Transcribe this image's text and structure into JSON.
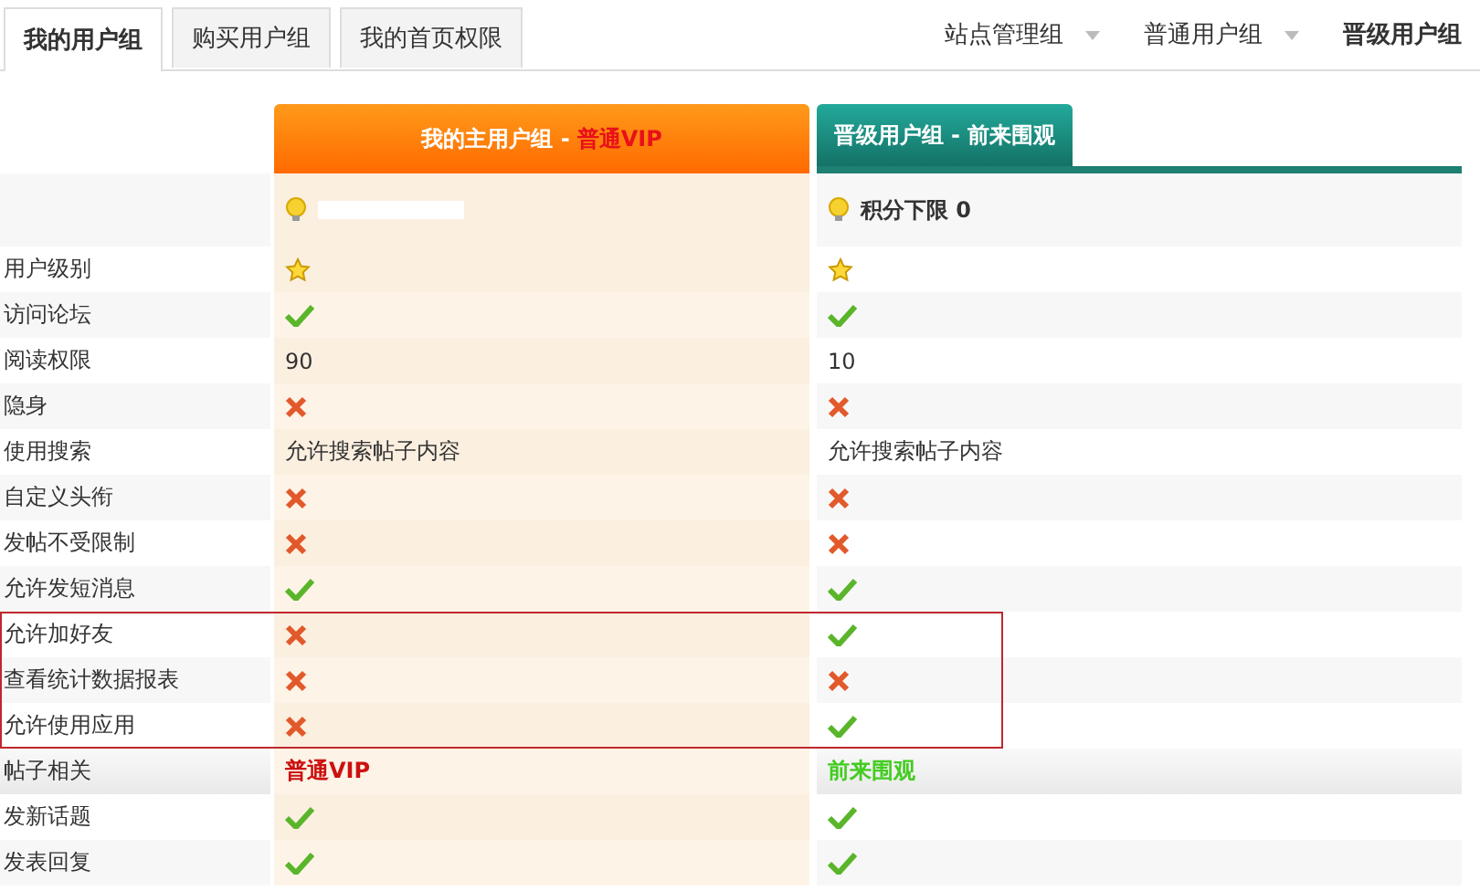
{
  "tabs": [
    {
      "label": "我的用户组",
      "selected": true
    },
    {
      "label": "购买用户组",
      "selected": false
    },
    {
      "label": "我的首页权限",
      "selected": false
    }
  ],
  "group_links": [
    {
      "label": "站点管理组",
      "dropdown": true,
      "selected": false
    },
    {
      "label": "普通用户组",
      "dropdown": true,
      "selected": false
    },
    {
      "label": "晋级用户组",
      "dropdown": false,
      "selected": true
    }
  ],
  "columns": [
    {
      "title": "我的主用户组 - ",
      "group": "普通VIP",
      "kind": "main"
    },
    {
      "title": "晋级用户组 - 前来围观",
      "kind": "upgrade",
      "points": "积分下限 0"
    }
  ],
  "rows": [
    {
      "label": "用户级别",
      "kind": "perm",
      "highlighted": false,
      "cells": [
        {
          "kind": "star"
        },
        {
          "kind": "star"
        }
      ]
    },
    {
      "label": "访问论坛",
      "kind": "perm",
      "highlighted": false,
      "cells": [
        {
          "kind": "check"
        },
        {
          "kind": "check"
        }
      ]
    },
    {
      "label": "阅读权限",
      "kind": "perm",
      "highlighted": false,
      "cells": [
        {
          "kind": "text",
          "text": "90"
        },
        {
          "kind": "text",
          "text": "10"
        }
      ]
    },
    {
      "label": "隐身",
      "kind": "perm",
      "highlighted": false,
      "cells": [
        {
          "kind": "cross"
        },
        {
          "kind": "cross"
        }
      ]
    },
    {
      "label": "使用搜索",
      "kind": "perm",
      "highlighted": false,
      "cells": [
        {
          "kind": "text",
          "text": "允许搜索帖子内容"
        },
        {
          "kind": "text",
          "text": "允许搜索帖子内容"
        }
      ]
    },
    {
      "label": "自定义头衔",
      "kind": "perm",
      "highlighted": false,
      "cells": [
        {
          "kind": "cross"
        },
        {
          "kind": "cross"
        }
      ]
    },
    {
      "label": "发帖不受限制",
      "kind": "perm",
      "highlighted": false,
      "cells": [
        {
          "kind": "cross"
        },
        {
          "kind": "cross"
        }
      ]
    },
    {
      "label": "允许发短消息",
      "kind": "perm",
      "highlighted": false,
      "cells": [
        {
          "kind": "check"
        },
        {
          "kind": "check"
        }
      ]
    },
    {
      "label": "允许加好友",
      "kind": "perm",
      "highlighted": true,
      "cells": [
        {
          "kind": "cross"
        },
        {
          "kind": "check"
        }
      ]
    },
    {
      "label": "查看统计数据报表",
      "kind": "perm",
      "highlighted": true,
      "cells": [
        {
          "kind": "cross"
        },
        {
          "kind": "cross"
        }
      ]
    },
    {
      "label": "允许使用应用",
      "kind": "perm",
      "highlighted": true,
      "cells": [
        {
          "kind": "cross"
        },
        {
          "kind": "check"
        }
      ]
    },
    {
      "label": "帖子相关",
      "kind": "section",
      "highlighted": false,
      "cells": [
        {
          "kind": "text",
          "text": "普通VIP",
          "color": "#cc1111"
        },
        {
          "kind": "text",
          "text": "前来围观",
          "color": "#44cc22"
        }
      ]
    },
    {
      "label": "发新话题",
      "kind": "perm",
      "highlighted": false,
      "cells": [
        {
          "kind": "check"
        },
        {
          "kind": "check"
        }
      ]
    },
    {
      "label": "发表回复",
      "kind": "perm",
      "highlighted": false,
      "cells": [
        {
          "kind": "check"
        },
        {
          "kind": "check"
        }
      ]
    }
  ]
}
